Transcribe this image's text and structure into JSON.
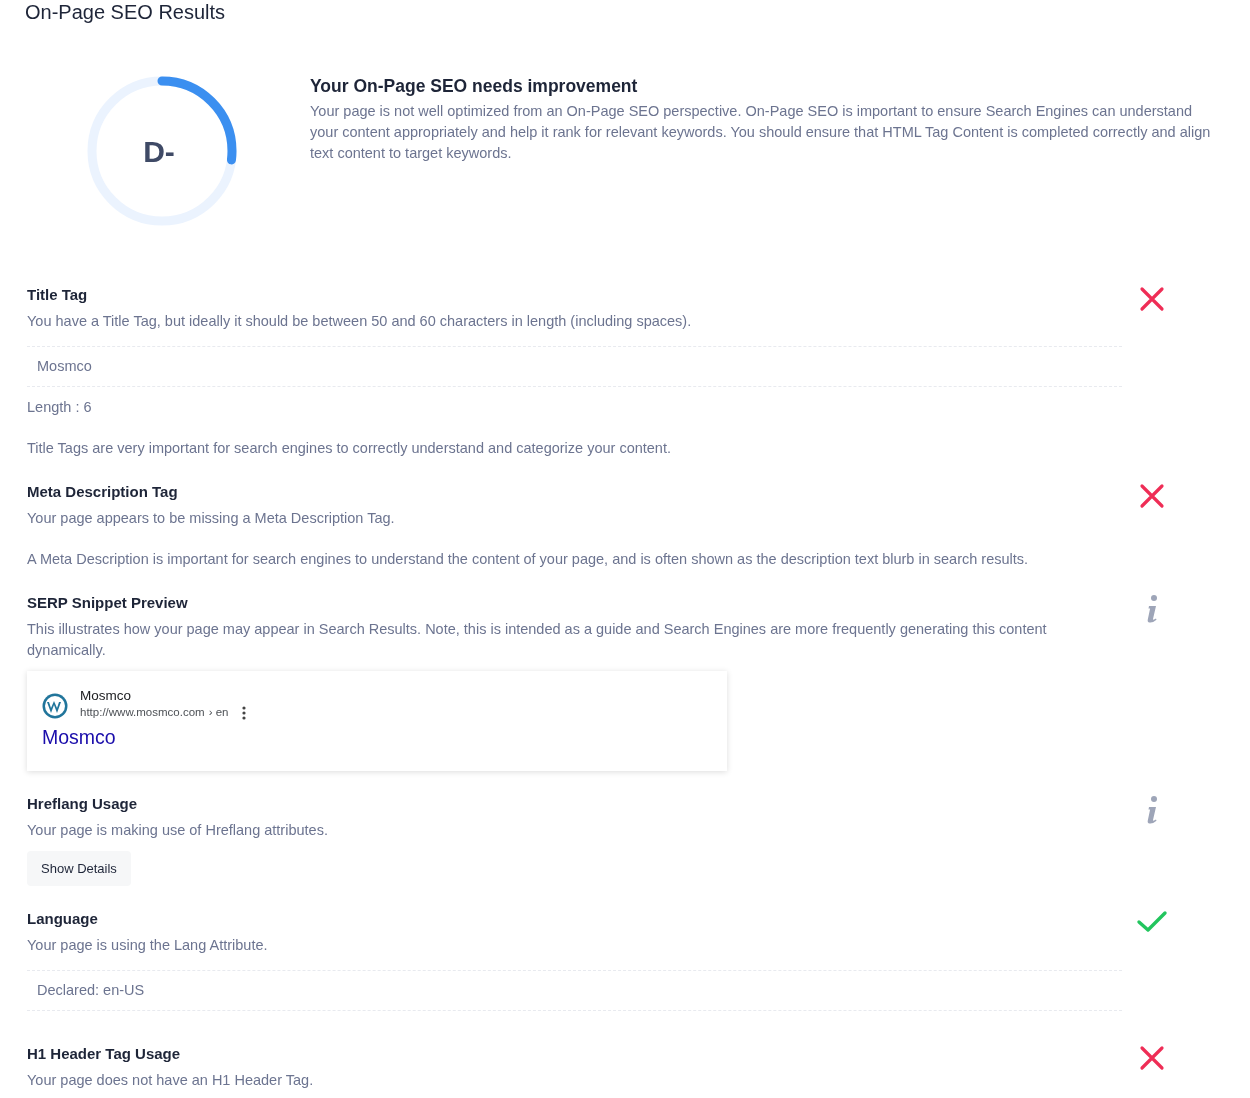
{
  "page_title": "On-Page SEO Results",
  "summary": {
    "grade": "D-",
    "heading": "Your On-Page SEO needs improvement",
    "text": "Your page is not well optimized from an On-Page SEO perspective. On-Page SEO is important to ensure Search Engines can understand your content appropriately and help it rank for relevant keywords. You should ensure that HTML Tag Content is completed correctly and align text content to target keywords."
  },
  "checks": [
    {
      "title": "Title Tag",
      "kind": "fail",
      "description": "You have a Title Tag, but ideally it should be between 50 and 60 characters in length (including spaces).",
      "value": "Mosmco",
      "length": "Length : 6",
      "note": "Title Tags are very important for search engines to correctly understand and categorize your content."
    },
    {
      "title": "Meta Description Tag",
      "kind": "fail",
      "description": "Your page appears to be missing a Meta Description Tag.",
      "note": "A Meta Description is important for search engines to understand the content of your page, and is often shown as the description text blurb in search results."
    },
    {
      "title": "SERP Snippet Preview",
      "kind": "info",
      "description": "This illustrates how your page may appear in Search Results. Note, this is intended as a guide and Search Engines are more frequently generating this content dynamically.",
      "serp": {
        "site_name": "Mosmco",
        "url": "http://www.mosmco.com",
        "path": "› en",
        "title": "Mosmco"
      }
    },
    {
      "title": "Hreflang Usage",
      "kind": "info",
      "description": "Your page is making use of Hreflang attributes.",
      "button": "Show Details"
    },
    {
      "title": "Language",
      "kind": "pass",
      "description": "Your page is using the Lang Attribute.",
      "value": "Declared: en-US"
    },
    {
      "title": "H1 Header Tag Usage",
      "kind": "fail",
      "description": "Your page does not have an H1 Header Tag."
    }
  ]
}
